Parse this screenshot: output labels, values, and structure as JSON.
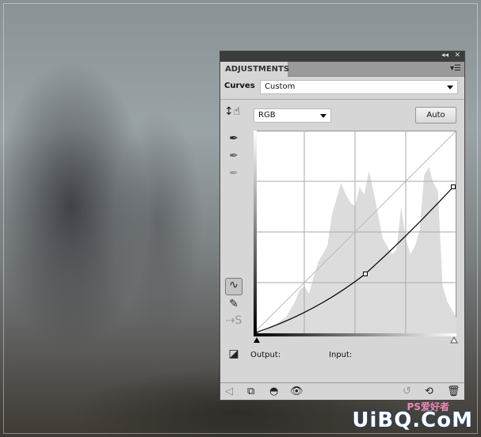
{
  "panel": {
    "title": "ADJUSTMENTS",
    "preset_label": "Curves",
    "preset_value": "Custom",
    "channel": "RGB",
    "auto_label": "Auto",
    "output_label": "Output:",
    "input_label": "Input:"
  },
  "curve": {
    "points": [
      [
        0,
        0
      ],
      [
        141,
        75
      ],
      [
        252,
        185
      ]
    ],
    "histogram_color": "#dcdcdc"
  },
  "watermark": {
    "text": "UiBQ.CoM",
    "subtext": "PS爱好者"
  }
}
